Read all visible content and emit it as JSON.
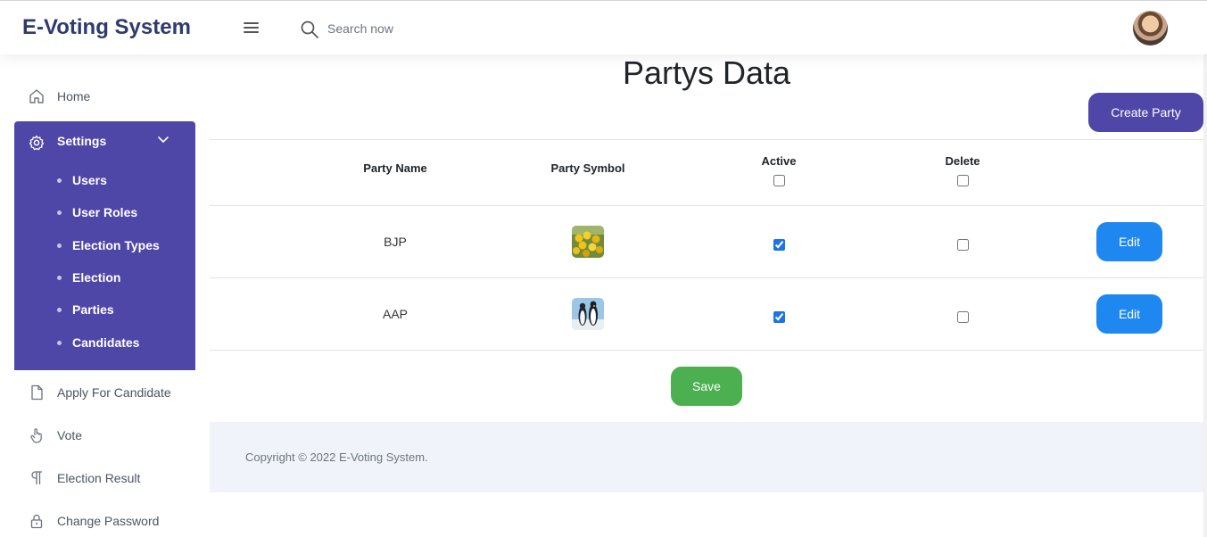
{
  "header": {
    "brand": "E-Voting System",
    "search_placeholder": "Search now"
  },
  "sidebar": {
    "items_top": [
      {
        "label": "Home",
        "icon": "home-icon"
      }
    ],
    "settings": {
      "label": "Settings",
      "icon": "gear-icon",
      "sub_items": [
        "Users",
        "User Roles",
        "Election Types",
        "Election",
        "Parties",
        "Candidates"
      ]
    },
    "items_bottom": [
      {
        "label": "Apply For Candidate",
        "icon": "document-icon"
      },
      {
        "label": "Vote",
        "icon": "hand-pointer-icon"
      },
      {
        "label": "Election Result",
        "icon": "paragraph-icon"
      },
      {
        "label": "Change Password",
        "icon": "lock-icon"
      }
    ]
  },
  "main": {
    "title": "Partys Data",
    "create_button": "Create Party",
    "table": {
      "headers": {
        "party_name": "Party Name",
        "party_symbol": "Party Symbol",
        "active": "Active",
        "delete": "Delete"
      },
      "rows": [
        {
          "name": "BJP",
          "symbol": "tulips-image",
          "active": true,
          "delete": false,
          "edit_label": "Edit"
        },
        {
          "name": "AAP",
          "symbol": "penguins-image",
          "active": true,
          "delete": false,
          "edit_label": "Edit"
        }
      ]
    },
    "save_button": "Save"
  },
  "footer": {
    "copyright": "Copyright © 2022 E-Voting System."
  },
  "colors": {
    "brand": "#2f3a6e",
    "primary": "#4f47a8",
    "edit": "#1e88f0",
    "save": "#4caf50"
  }
}
